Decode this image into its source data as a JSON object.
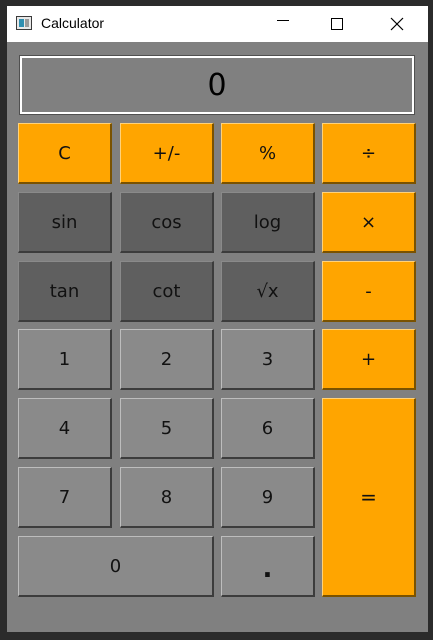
{
  "window": {
    "title": "Calculator",
    "icons": {
      "app": "calculator-app-icon",
      "minimize": "minimize-icon",
      "maximize": "maximize-icon",
      "close": "close-icon"
    }
  },
  "display": {
    "value": "0"
  },
  "buttons": {
    "clear": "C",
    "sign": "+/-",
    "percent": "%",
    "divide": "÷",
    "sin": "sin",
    "cos": "cos",
    "log": "log",
    "multiply": "×",
    "tan": "tan",
    "cot": "cot",
    "sqrt": "√x",
    "subtract": "-",
    "one": "1",
    "two": "2",
    "three": "3",
    "add": "+",
    "four": "4",
    "five": "5",
    "six": "6",
    "equals": "=",
    "seven": "7",
    "eight": "8",
    "nine": "9",
    "zero": "0",
    "decimal": "."
  },
  "colors": {
    "operator": "#ffa500",
    "function": "#5f5f5f",
    "number": "#8a8a8a",
    "background": "#808080"
  }
}
